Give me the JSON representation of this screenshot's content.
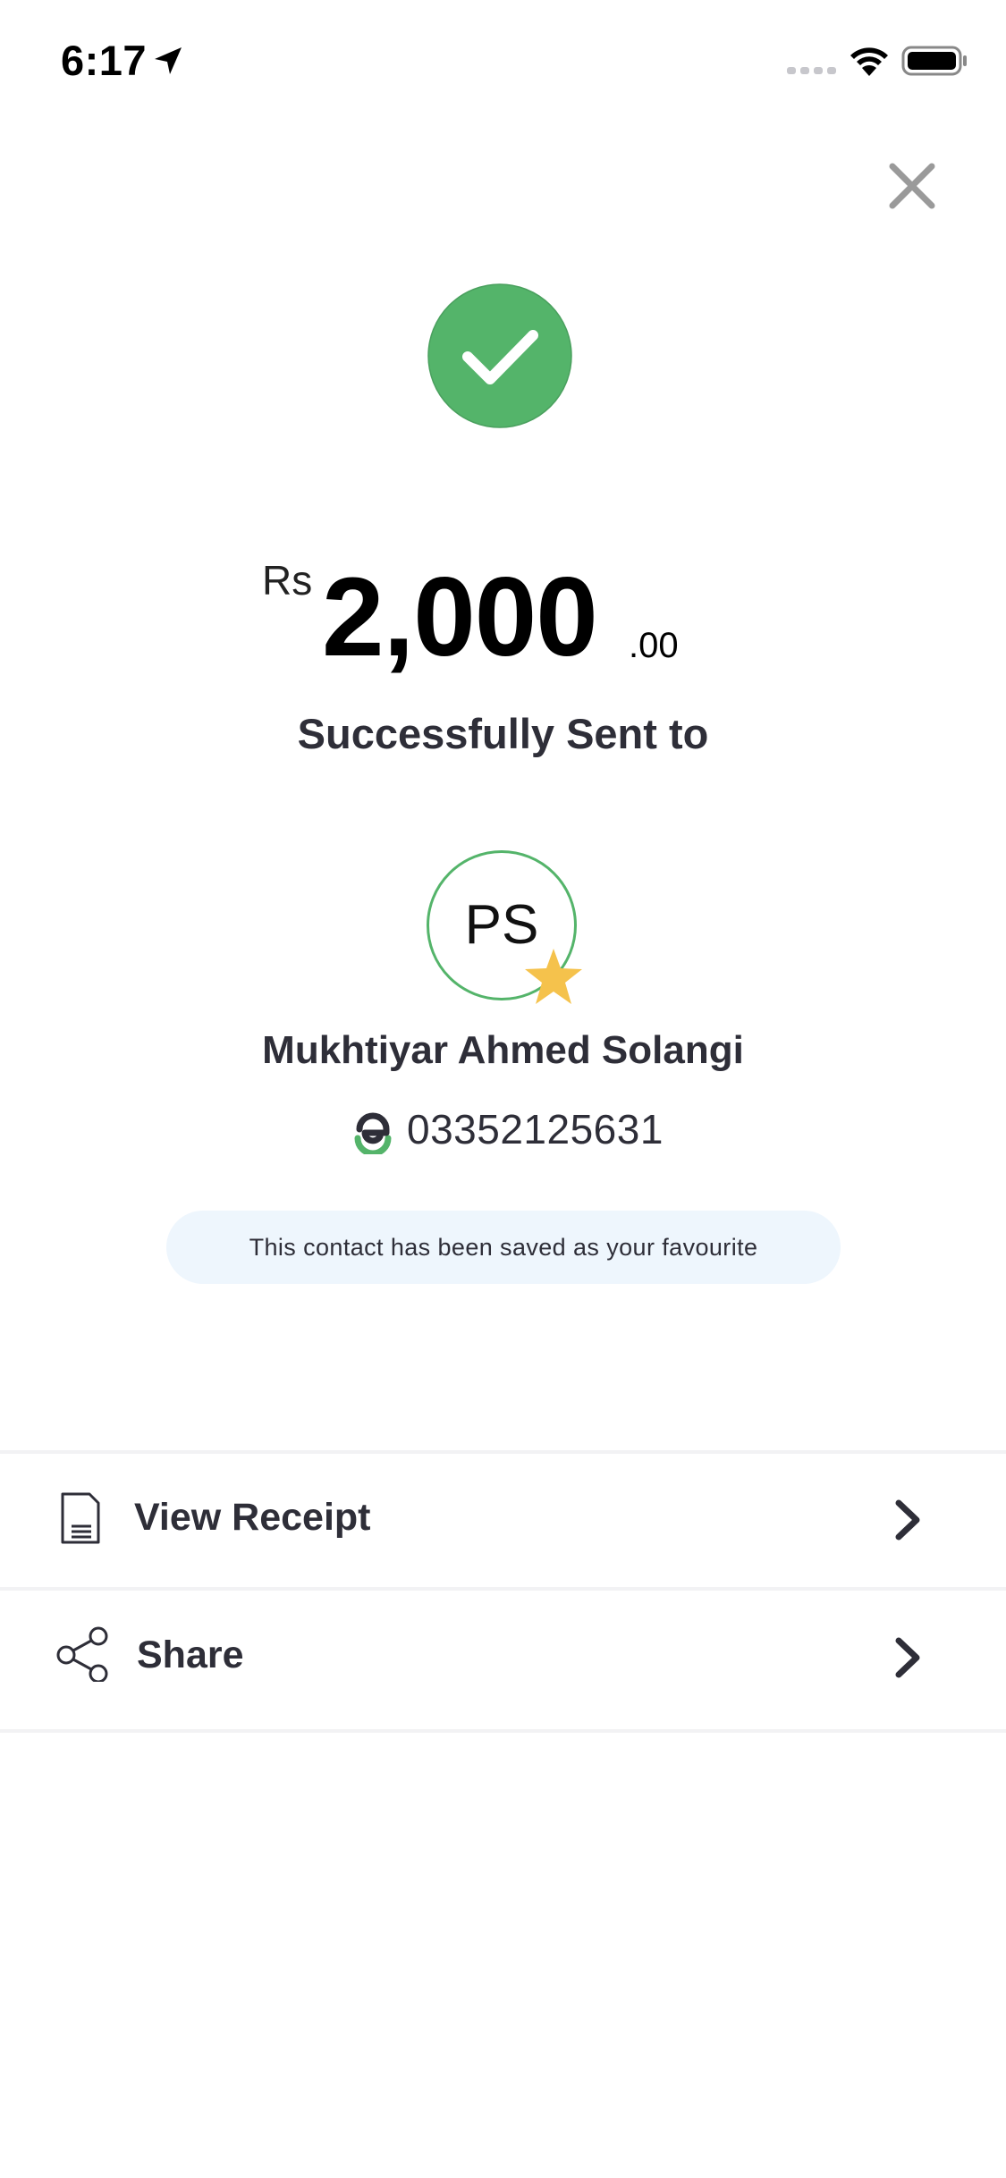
{
  "status_bar": {
    "time": "6:17"
  },
  "transaction": {
    "currency": "Rs",
    "amount_whole": "2,000",
    "amount_decimal": ".00",
    "status_text": "Successfully Sent to"
  },
  "recipient": {
    "initials": "PS",
    "name": "Mukhtiyar Ahmed Solangi",
    "phone": "03352125631",
    "favourite_message": "This contact has been saved as your favourite"
  },
  "actions": [
    {
      "label": "View Receipt",
      "icon": "receipt-icon"
    },
    {
      "label": "Share",
      "icon": "share-icon"
    }
  ],
  "colors": {
    "success_green": "#54b46a",
    "star_yellow": "#f5c24c",
    "banner_bg": "#eef6fd",
    "text_dark": "#2e2e38"
  }
}
